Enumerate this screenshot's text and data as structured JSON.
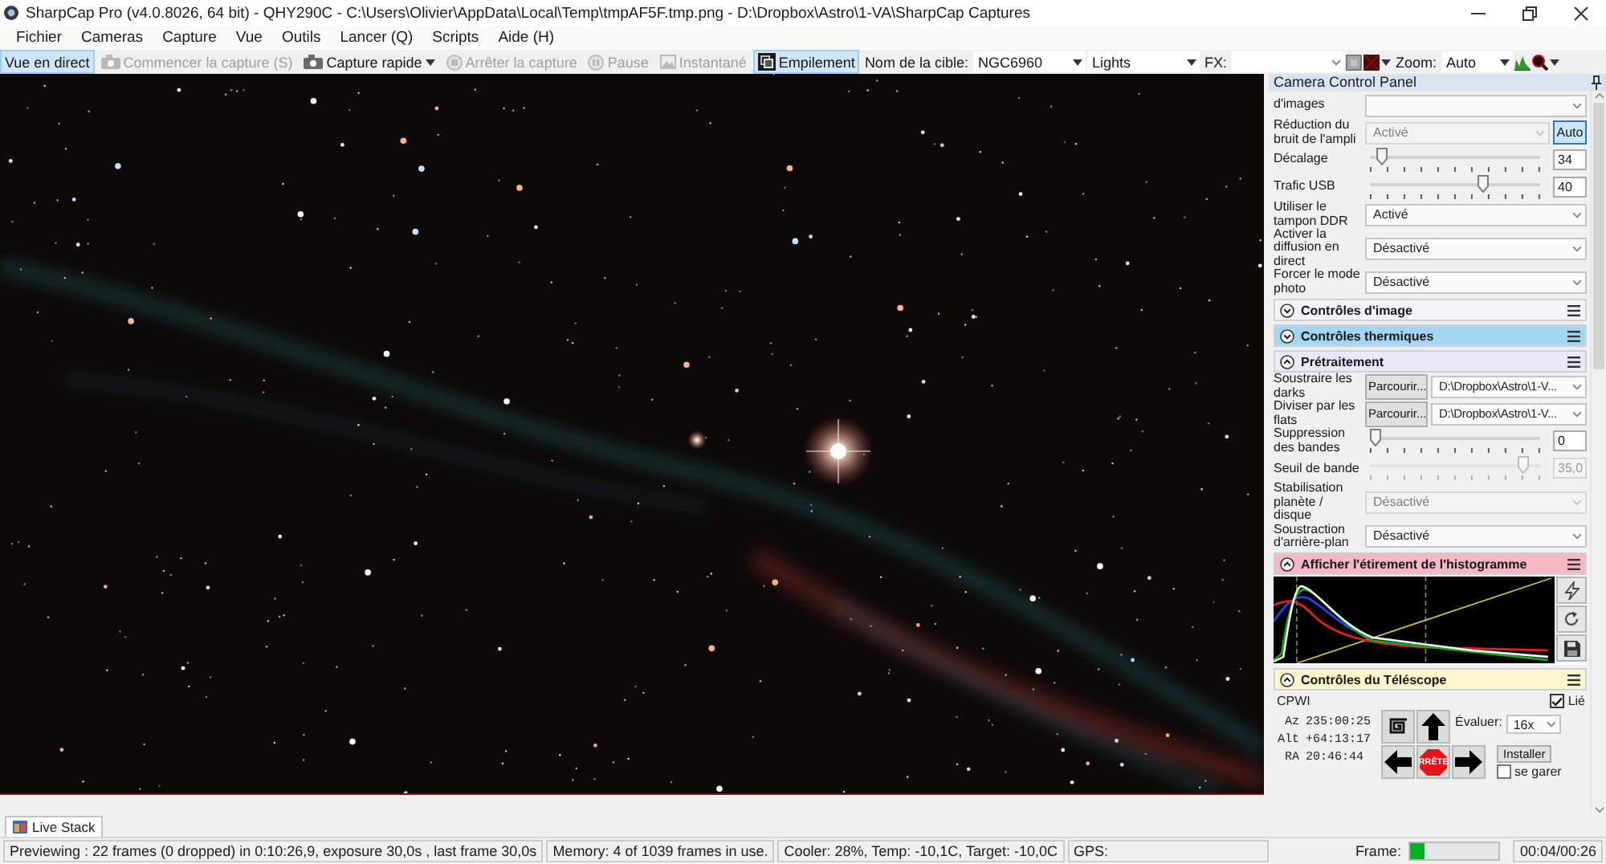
{
  "window": {
    "title": "SharpCap Pro (v4.0.8026, 64 bit) - QHY290C - C:\\Users\\Olivier\\AppData\\Local\\Temp\\tmpAF5F.tmp.png - D:\\Dropbox\\Astro\\1-VA\\SharpCap Captures"
  },
  "menu": [
    "Fichier",
    "Cameras",
    "Capture",
    "Vue",
    "Outils",
    "Lancer (Q)",
    "Scripts",
    "Aide (H)"
  ],
  "toolbar": {
    "buttons": [
      {
        "kind": "plain",
        "label": "Vue en direct",
        "selected": true,
        "disabled": false
      },
      {
        "kind": "camera",
        "label": "Commencer la capture (S)",
        "selected": false,
        "disabled": true
      },
      {
        "kind": "menu",
        "label": "Capture rapide",
        "selected": false,
        "disabled": false
      },
      {
        "kind": "stop",
        "label": "Arrêter la capture",
        "selected": false,
        "disabled": true
      },
      {
        "kind": "pause",
        "label": "Pause",
        "selected": false,
        "disabled": true
      },
      {
        "kind": "snapshot",
        "label": "Instantané",
        "selected": false,
        "disabled": true
      },
      {
        "kind": "stack",
        "label": "Empilement",
        "selected": true,
        "disabled": false
      }
    ],
    "target": {
      "label": "Nom de la cible:",
      "value": "NGC6960"
    },
    "frame_type": {
      "value": "Lights"
    },
    "fx": {
      "label": "FX:"
    },
    "zoom": {
      "label": "Zoom:",
      "value": "Auto"
    }
  },
  "control_panel": {
    "title": "Camera Control Panel",
    "rows": [
      {
        "kind": "combo",
        "label": "d'images",
        "disabled": false
      },
      {
        "kind": "combo",
        "label": "Réduction du bruit de l'ampli",
        "value": "Activé",
        "disabled": true,
        "button": {
          "label": "Auto",
          "selected": true
        }
      },
      {
        "kind": "slider",
        "label": "Décalage",
        "level": 0.04,
        "value": "34",
        "disabled": false
      },
      {
        "kind": "slider",
        "label": "Trafic USB",
        "level": 0.68,
        "value": "40",
        "disabled": false
      },
      {
        "kind": "combo",
        "label": "Utiliser le tampon DDR",
        "value": "Activé",
        "disabled": false
      },
      {
        "kind": "combo",
        "label": "Activer la diffusion en direct",
        "value": "Désactivé",
        "disabled": false
      },
      {
        "kind": "combo",
        "label": "Forcer le mode photo",
        "value": "Désactivé",
        "disabled": false
      }
    ],
    "sections": [
      {
        "title": "Contrôles d'image",
        "expanded": false,
        "color": "#f3f3f8"
      },
      {
        "title": "Contrôles thermiques",
        "expanded": false,
        "color": "#a3d6f3"
      },
      {
        "kind": "rows",
        "title": "Prétraitement",
        "expanded": true,
        "color": "#e9e8f5",
        "rows": [
          {
            "kind": "file",
            "label": "Soustraire les darks",
            "button": "Parcourir...",
            "value": "D:\\Dropbox\\Astro\\1-V...",
            "disabled": false
          },
          {
            "kind": "file",
            "label": "Diviser par les flats",
            "button": "Parcourir...",
            "value": "D:\\Dropbox\\Astro\\1-V...",
            "disabled": false
          },
          {
            "kind": "slider",
            "label": "Suppression des bandes",
            "level": 0,
            "value": "0",
            "disabled": false
          },
          {
            "kind": "slider",
            "label": "Seuil de bande",
            "level": 0.93,
            "value": "35,0",
            "disabled": true
          },
          {
            "kind": "combo",
            "label": "Stabilisation planète / disque",
            "value": "Désactivé",
            "disabled": true
          },
          {
            "kind": "combo",
            "label": "Soustraction d'arrière-plan",
            "value": "Désactivé",
            "disabled": false
          }
        ]
      },
      {
        "kind": "histogram",
        "title": "Afficher l'étirement de l'histogramme",
        "expanded": true,
        "color": "#f6b7c5"
      },
      {
        "kind": "telescope",
        "title": "Contrôles du Téléscope",
        "expanded": true,
        "color": "#fbf6cd",
        "telescope": {
          "mount": "CPWI",
          "linked": {
            "label": "Lié",
            "checked": true
          },
          "coords": [
            {
              "label": "Az",
              "value": "235:00:25"
            },
            {
              "label": "Alt",
              "value": "+64:13:17"
            },
            {
              "label": "RA",
              "value": "20:46:44"
            }
          ],
          "stop": "RRÊTE",
          "rate": {
            "label": "Évaluer:",
            "value": "16x"
          },
          "install": "Installer",
          "park": {
            "label": "se garer",
            "checked": false
          }
        }
      }
    ]
  },
  "bottom_tabs": [
    {
      "label": "Live Stack",
      "selected": true
    }
  ],
  "status_bar": {
    "segments": [
      "Previewing : 22 frames (0 dropped) in 0:10:26,9, exposure 30,0s , last frame 30,0s",
      "Memory: 4 of 1039 frames in use.",
      "Cooler: 28%, Temp: -10,1C, Target: -10,0C",
      "GPS:"
    ],
    "frame": {
      "label": "Frame:",
      "level": 0.15
    },
    "time": "00:04/00:26"
  }
}
